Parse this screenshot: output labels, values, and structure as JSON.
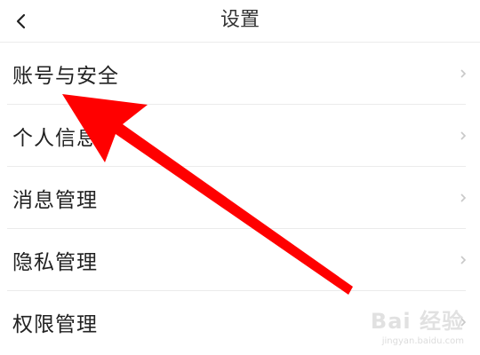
{
  "header": {
    "title": "设置",
    "back_icon": "chevron-left-icon"
  },
  "settings_items": [
    {
      "label": "账号与安全"
    },
    {
      "label": "个人信息"
    },
    {
      "label": "消息管理"
    },
    {
      "label": "隐私管理"
    },
    {
      "label": "权限管理"
    }
  ],
  "annotation": {
    "type": "arrow",
    "color": "#ff0000"
  },
  "watermark": {
    "brand": "Bai 经验",
    "url": "jingyan.baidu.com"
  },
  "colors": {
    "divider": "#ebebeb",
    "chevron": "#c8c8c8",
    "text": "#222222"
  }
}
